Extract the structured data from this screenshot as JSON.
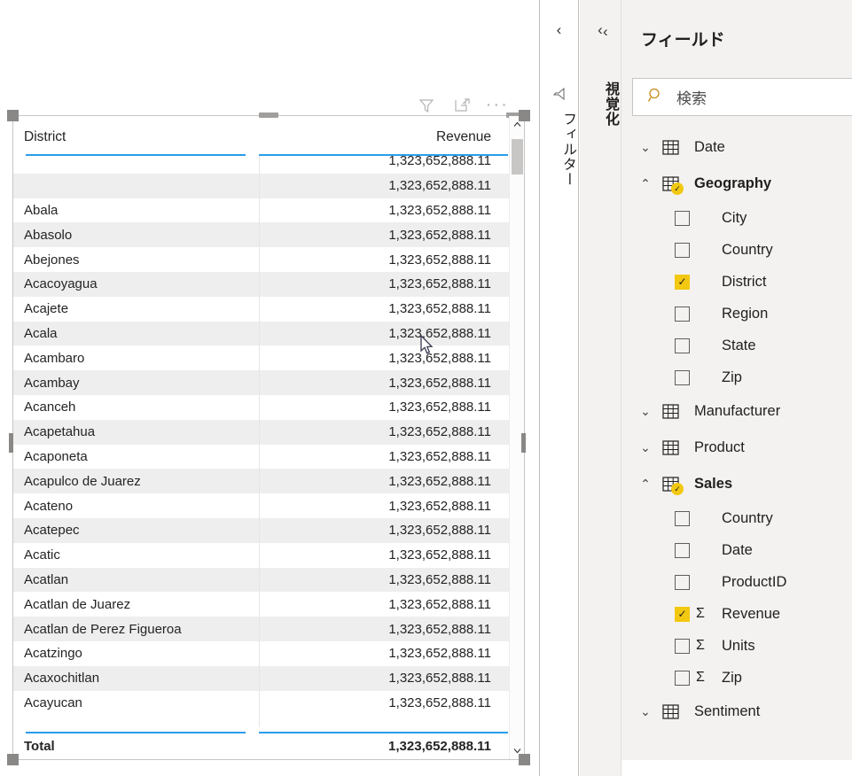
{
  "visual_toolbar": {
    "filter_icon": "filter-funnel-icon",
    "focus_icon": "focus-mode-icon",
    "more_icon": "more-options-icon",
    "more_label": "···"
  },
  "table": {
    "columns": [
      "District",
      "Revenue"
    ],
    "rows": [
      {
        "district": "",
        "revenue": "1,323,652,888.11"
      },
      {
        "district": "",
        "revenue": "1,323,652,888.11"
      },
      {
        "district": "Abala",
        "revenue": "1,323,652,888.11"
      },
      {
        "district": "Abasolo",
        "revenue": "1,323,652,888.11"
      },
      {
        "district": "Abejones",
        "revenue": "1,323,652,888.11"
      },
      {
        "district": "Acacoyagua",
        "revenue": "1,323,652,888.11"
      },
      {
        "district": "Acajete",
        "revenue": "1,323,652,888.11"
      },
      {
        "district": "Acala",
        "revenue": "1,323,652,888.11"
      },
      {
        "district": "Acambaro",
        "revenue": "1,323,652,888.11"
      },
      {
        "district": "Acambay",
        "revenue": "1,323,652,888.11"
      },
      {
        "district": "Acanceh",
        "revenue": "1,323,652,888.11"
      },
      {
        "district": "Acapetahua",
        "revenue": "1,323,652,888.11"
      },
      {
        "district": "Acaponeta",
        "revenue": "1,323,652,888.11"
      },
      {
        "district": "Acapulco de Juarez",
        "revenue": "1,323,652,888.11"
      },
      {
        "district": "Acateno",
        "revenue": "1,323,652,888.11"
      },
      {
        "district": "Acatepec",
        "revenue": "1,323,652,888.11"
      },
      {
        "district": "Acatic",
        "revenue": "1,323,652,888.11"
      },
      {
        "district": "Acatlan",
        "revenue": "1,323,652,888.11"
      },
      {
        "district": "Acatlan de Juarez",
        "revenue": "1,323,652,888.11"
      },
      {
        "district": "Acatlan de Perez Figueroa",
        "revenue": "1,323,652,888.11"
      },
      {
        "district": "Acatzingo",
        "revenue": "1,323,652,888.11"
      },
      {
        "district": "Acaxochitlan",
        "revenue": "1,323,652,888.11"
      },
      {
        "district": "Acayucan",
        "revenue": "1,323,652,888.11"
      }
    ],
    "total": {
      "label": "Total",
      "revenue": "1,323,652,888.11"
    }
  },
  "rails": {
    "filters": {
      "label": "フィルター",
      "chevron": "‹",
      "icon": "filter-funnel-icon"
    },
    "visualizations": {
      "label": "視覚化",
      "chevron": "‹"
    }
  },
  "fields_pane": {
    "title": "フィールド",
    "chevron": "‹",
    "search_placeholder": "検索",
    "search_value": "",
    "tree": [
      {
        "name": "Date",
        "expanded": false,
        "chevron": "⌄",
        "bold": false,
        "checked_badge": false,
        "fields": []
      },
      {
        "name": "Geography",
        "expanded": true,
        "chevron": "⌃",
        "bold": true,
        "checked_badge": true,
        "fields": [
          {
            "label": "City",
            "checked": false,
            "measure": false
          },
          {
            "label": "Country",
            "checked": false,
            "measure": false
          },
          {
            "label": "District",
            "checked": true,
            "measure": false
          },
          {
            "label": "Region",
            "checked": false,
            "measure": false
          },
          {
            "label": "State",
            "checked": false,
            "measure": false
          },
          {
            "label": "Zip",
            "checked": false,
            "measure": false
          }
        ]
      },
      {
        "name": "Manufacturer",
        "expanded": false,
        "chevron": "⌄",
        "bold": false,
        "checked_badge": false,
        "fields": []
      },
      {
        "name": "Product",
        "expanded": false,
        "chevron": "⌄",
        "bold": false,
        "checked_badge": false,
        "fields": []
      },
      {
        "name": "Sales",
        "expanded": true,
        "chevron": "⌃",
        "bold": true,
        "checked_badge": true,
        "fields": [
          {
            "label": "Country",
            "checked": false,
            "measure": false
          },
          {
            "label": "Date",
            "checked": false,
            "measure": false
          },
          {
            "label": "ProductID",
            "checked": false,
            "measure": false
          },
          {
            "label": "Revenue",
            "checked": true,
            "measure": true
          },
          {
            "label": "Units",
            "checked": false,
            "measure": true
          },
          {
            "label": "Zip",
            "checked": false,
            "measure": true
          }
        ]
      },
      {
        "name": "Sentiment",
        "expanded": false,
        "chevron": "⌄",
        "bold": false,
        "checked_badge": false,
        "fields": []
      }
    ],
    "sigma_symbol": "Σ",
    "check_glyph": "✓"
  },
  "colors": {
    "accent_blue": "#2b9dea",
    "badge_yellow": "#f2c811",
    "zebra": "#eeeeee",
    "panel_bg": "#f3f2f1"
  }
}
